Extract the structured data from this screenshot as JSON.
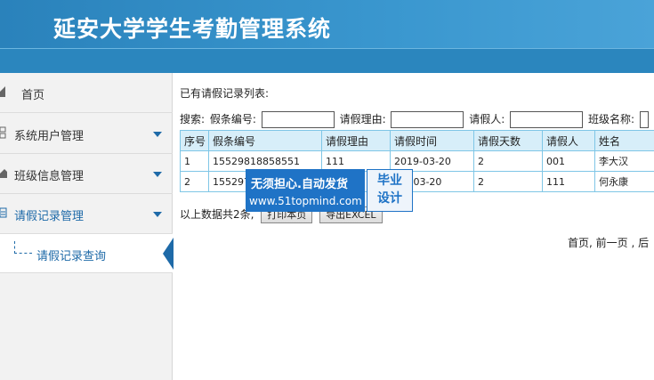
{
  "app": {
    "title": "延安大学学生考勤管理系统"
  },
  "sidebar": {
    "items": [
      {
        "label": "首页",
        "icon": "home-icon"
      },
      {
        "label": "系统用户管理",
        "icon": "users-icon"
      },
      {
        "label": "班级信息管理",
        "icon": "class-icon"
      },
      {
        "label": "请假记录管理",
        "icon": "leave-icon"
      }
    ],
    "subitem": {
      "label": "请假记录查询"
    }
  },
  "main": {
    "list_title": "已有请假记录列表:",
    "search": {
      "prefix": "搜索:",
      "fields": [
        {
          "label": "假条编号:",
          "value": ""
        },
        {
          "label": "请假理由:",
          "value": ""
        },
        {
          "label": "请假人:",
          "value": ""
        },
        {
          "label": "班级名称:",
          "value": ""
        }
      ]
    },
    "table": {
      "columns": [
        "序号",
        "假条编号",
        "请假理由",
        "请假时间",
        "请假天数",
        "请假人",
        "姓名"
      ],
      "rows": [
        [
          "1",
          "15529818858551",
          "111",
          "2019-03-20",
          "2",
          "001",
          "李大汉"
        ],
        [
          "2",
          "155297",
          "111",
          ".19-03-20",
          "2",
          "111",
          "何永康"
        ]
      ]
    },
    "total_text": "以上数据共2条,",
    "print_button": "打印本页",
    "export_button": "导出EXCEL",
    "pager": "首页, 前一页 , 后"
  },
  "watermark": {
    "line1": "无须担心.自动发货",
    "line2": "www.51topmind.com",
    "badge_top": "毕业",
    "badge_bottom": "设计"
  },
  "colors": {
    "header": "#2e8cc4",
    "accent": "#1e6aa8",
    "table_header": "#d7eef9",
    "table_border": "#7fc6e6",
    "watermark": "#1f73c6"
  }
}
